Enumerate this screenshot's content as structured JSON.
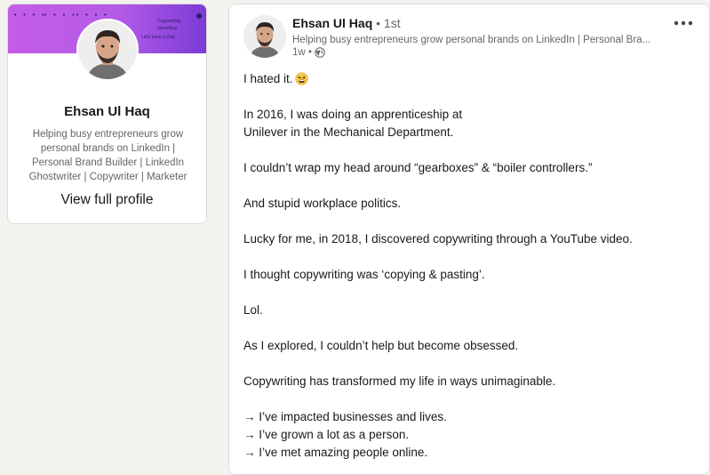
{
  "profile_card": {
    "cover_texts": [
      "Copywriting",
      "Marketing",
      "Let's have a chat"
    ],
    "name": "Ehsan Ul Haq",
    "headline": "Helping busy entrepreneurs grow personal brands on LinkedIn | Personal Brand Builder | LinkedIn Ghostwriter | Copywriter | Marketer",
    "view_profile_label": "View full profile",
    "cover_colors": [
      "#c45ce8",
      "#7a3cd6"
    ]
  },
  "post": {
    "author_name": "Ehsan Ul Haq",
    "author_degree": " • 1st",
    "author_headline": "Helping busy entrepreneurs grow personal brands on LinkedIn | Personal Bra...",
    "time_ago": "1w •",
    "visibility_icon": "globe-icon",
    "more_icon": "more-icon",
    "paragraphs": [
      "I hated it.",
      "In 2016, I was doing an apprenticeship at",
      "Unilever in the Mechanical Department.",
      "I couldn’t wrap my head around “gearboxes” & “boiler controllers.”",
      "And stupid workplace politics.",
      "Lucky for me, in 2018, I discovered copywriting through a YouTube video.",
      "I thought copywriting was ‘copying & pasting’.",
      "Lol.",
      "As I explored, I couldn’t help but become obsessed.",
      "Copywriting has transformed my life in ways unimaginable.",
      "→ I’ve impacted businesses and lives.",
      "→ I’ve grown a lot as a person.",
      "→ I’ve met amazing people online."
    ],
    "emoji_icon": "tired-face-emoji"
  }
}
